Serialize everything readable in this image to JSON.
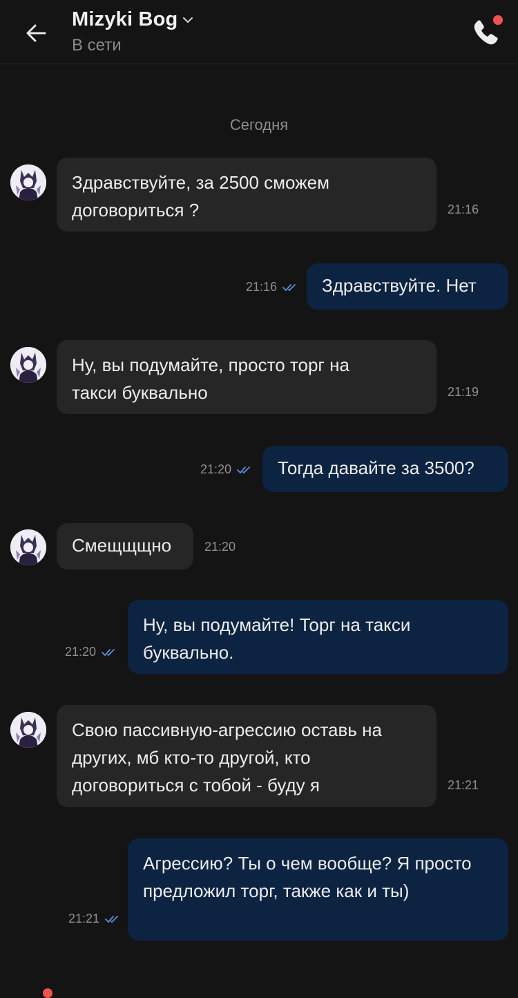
{
  "header": {
    "title": "Mizyki Bog",
    "status": "В сети"
  },
  "date_separator": "Сегодня",
  "messages": [
    {
      "direction": "incoming",
      "text": "Здравствуйте, за 2500 сможем договориться ?",
      "time": "21:16"
    },
    {
      "direction": "outgoing",
      "text": "Здравствуйте. Нет",
      "time": "21:16"
    },
    {
      "direction": "incoming",
      "text": "Ну, вы подумайте, просто торг на такси буквально",
      "time": "21:19"
    },
    {
      "direction": "outgoing",
      "text": "Тогда давайте за 3500?",
      "time": "21:20"
    },
    {
      "direction": "incoming",
      "text": "Смещщщно",
      "time": "21:20"
    },
    {
      "direction": "outgoing",
      "text": "Ну, вы подумайте! Торг на такси буквально.",
      "time": "21:20"
    },
    {
      "direction": "incoming",
      "text": "Свою пассивную-агрессию оставь на других, мб кто-то другой, кто договориться с тобой - буду я",
      "time": "21:21"
    },
    {
      "direction": "outgoing",
      "text": "Агрессию? Ты о чем вообще? Я просто предложил торг, также как и ты)",
      "time": "21:21"
    }
  ],
  "colors": {
    "background": "#141414",
    "incoming_bubble": "#262626",
    "outgoing_bubble": "#0c2341",
    "read_ticks": "#5a8fd8",
    "notification_dot": "#ef5350"
  },
  "icons": [
    "back-arrow-icon",
    "chevron-down-icon",
    "phone-icon",
    "read-check-icon"
  ]
}
